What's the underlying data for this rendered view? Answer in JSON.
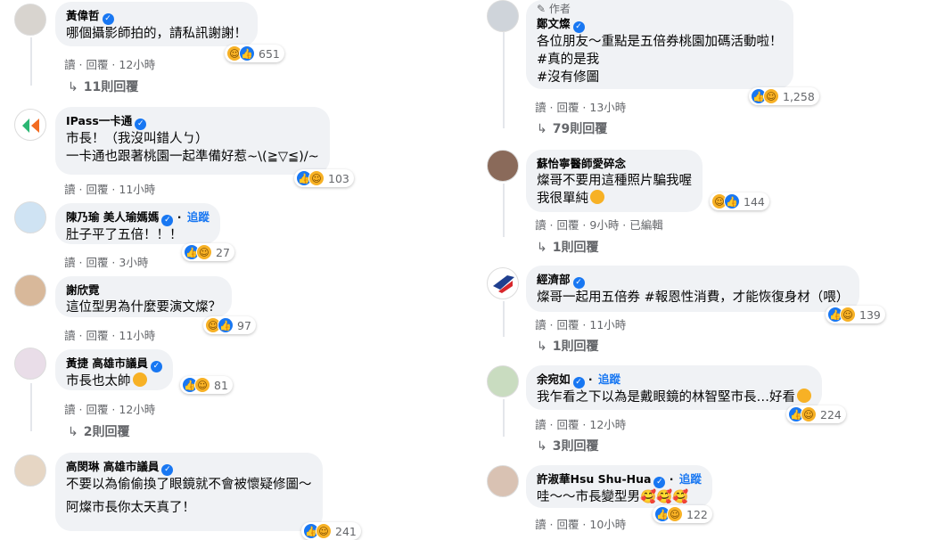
{
  "ui": {
    "verified_mark": "✓",
    "follow": "追蹤",
    "author_label": "作者",
    "read": "讀",
    "reply": "回覆",
    "sep": " · ",
    "reply_arrow": "↳",
    "accent": "#1877f2",
    "bubble_bg": "#f0f2f5",
    "muted": "#65676b"
  },
  "left": [
    {
      "name": "黃偉哲",
      "verified": true,
      "follow": false,
      "lines": [
        "哪個攝影師拍的，請私訊謝謝！"
      ],
      "time": "12小時",
      "reactions": [
        "haha",
        "like"
      ],
      "count": "651",
      "replies": "11則回覆"
    },
    {
      "name": "IPass一卡通",
      "verified": true,
      "follow": false,
      "lines": [
        "市長！（我沒叫錯人ㄅ）",
        "一卡通也跟著桃園一起準備好惹~\\(≧▽≦)/~"
      ],
      "time": "11小時",
      "reactions": [
        "like",
        "haha"
      ],
      "count": "103",
      "replies": ""
    },
    {
      "name": "陳乃瑜 美人瑜媽媽",
      "verified": true,
      "follow": true,
      "lines": [
        "肚子平了五倍！！！"
      ],
      "time": "3小時",
      "reactions": [
        "like",
        "haha"
      ],
      "count": "27",
      "replies": ""
    },
    {
      "name": "謝欣霓",
      "verified": false,
      "follow": false,
      "lines": [
        "這位型男為什麼要演文燦？"
      ],
      "time": "11小時",
      "reactions": [
        "haha",
        "like"
      ],
      "count": "97",
      "replies": ""
    },
    {
      "name": "黃捷 高雄市議員",
      "verified": true,
      "follow": false,
      "lines": [
        "市長也太帥"
      ],
      "time": "12小時",
      "reactions": [
        "like",
        "haha"
      ],
      "count": "81",
      "replies": "2則回覆"
    },
    {
      "name": "高閔琳 高雄市議員",
      "verified": true,
      "follow": false,
      "lines": [
        "不要以為偷偷換了眼鏡就不會被懷疑修圖～",
        "阿燦市長你太天真了！"
      ],
      "time": "",
      "reactions": [
        "like",
        "haha"
      ],
      "count": "241",
      "replies": ""
    }
  ],
  "right": [
    {
      "name": "鄭文燦",
      "verified": true,
      "follow": false,
      "author": true,
      "lines": [
        "各位朋友～重點是五倍券桃園加碼活動啦！",
        "#真的是我",
        "#沒有修圖"
      ],
      "time": "13小時",
      "edited": "",
      "reactions": [
        "like",
        "haha"
      ],
      "count": "1,258",
      "replies": "79則回覆"
    },
    {
      "name": "蘇怡寧醫師愛碎念",
      "verified": false,
      "follow": false,
      "author": false,
      "lines": [
        "燦哥不要用這種照片騙我喔",
        "我很單純"
      ],
      "time": "9小時",
      "edited": "已編輯",
      "reactions": [
        "haha",
        "like"
      ],
      "count": "144",
      "replies": "1則回覆"
    },
    {
      "name": "經濟部",
      "verified": true,
      "follow": false,
      "author": false,
      "lines": [
        "燦哥一起用五倍券 #報恩性消費，才能恢復身材（喂）"
      ],
      "time": "11小時",
      "edited": "",
      "reactions": [
        "like",
        "haha"
      ],
      "count": "139",
      "replies": "1則回覆"
    },
    {
      "name": "余宛如",
      "verified": true,
      "follow": true,
      "author": false,
      "lines": [
        "我乍看之下以為是戴眼鏡的林智堅市長…好看"
      ],
      "time": "12小時",
      "edited": "",
      "reactions": [
        "like",
        "haha"
      ],
      "count": "224",
      "replies": "3則回覆"
    },
    {
      "name": "許淑華Hsu Shu-Hua",
      "verified": true,
      "follow": true,
      "author": false,
      "lines": [
        "哇～～市長變型男🥰🥰🥰"
      ],
      "time": "10小時",
      "edited": "",
      "reactions": [
        "like",
        "haha"
      ],
      "count": "122",
      "replies": ""
    }
  ]
}
